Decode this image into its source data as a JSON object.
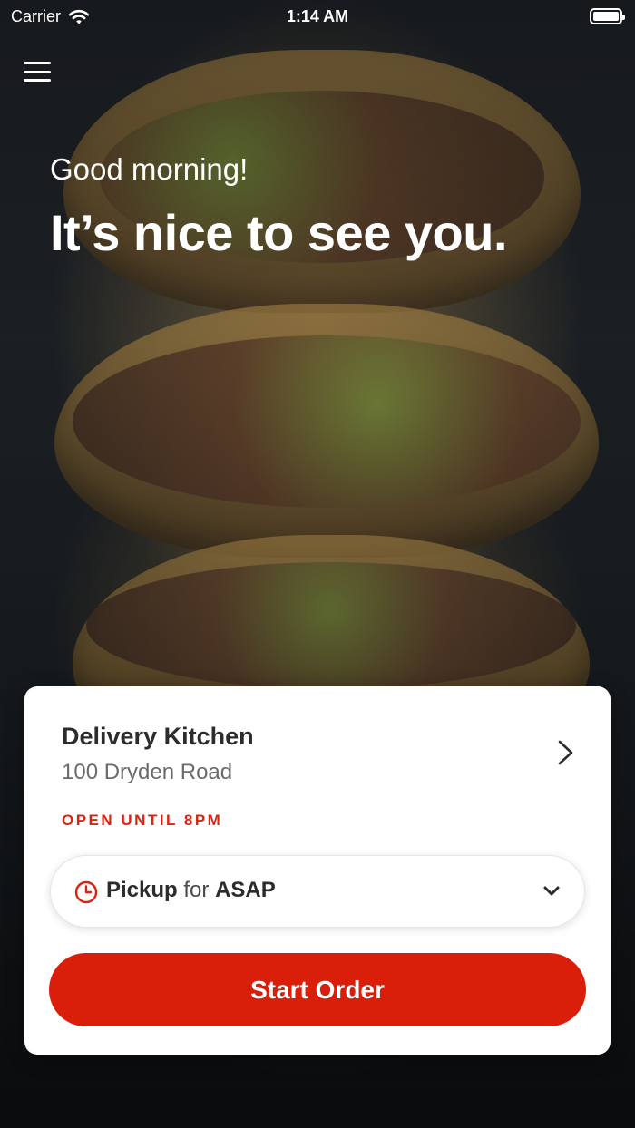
{
  "status_bar": {
    "carrier": "Carrier",
    "time": "1:14 AM"
  },
  "hero": {
    "greeting": "Good morning!",
    "headline": "It’s nice to see you."
  },
  "store_card": {
    "name": "Delivery Kitchen",
    "address": "100 Dryden Road",
    "status": "OPEN UNTIL 8PM",
    "pickup": {
      "mode": "Pickup",
      "connector": "for",
      "time": "ASAP"
    },
    "start_order_label": "Start Order"
  },
  "colors": {
    "brand_red": "#d91f0a",
    "status_red": "#d92410",
    "text_dark": "#2c2c2c",
    "text_muted": "#6b6b6b"
  },
  "icons": {
    "menu": "hamburger-menu-icon",
    "wifi": "wifi-icon",
    "battery": "battery-icon",
    "store_chevron": "chevron-right-icon",
    "clock": "clock-icon",
    "pickup_chevron": "chevron-down-icon"
  }
}
